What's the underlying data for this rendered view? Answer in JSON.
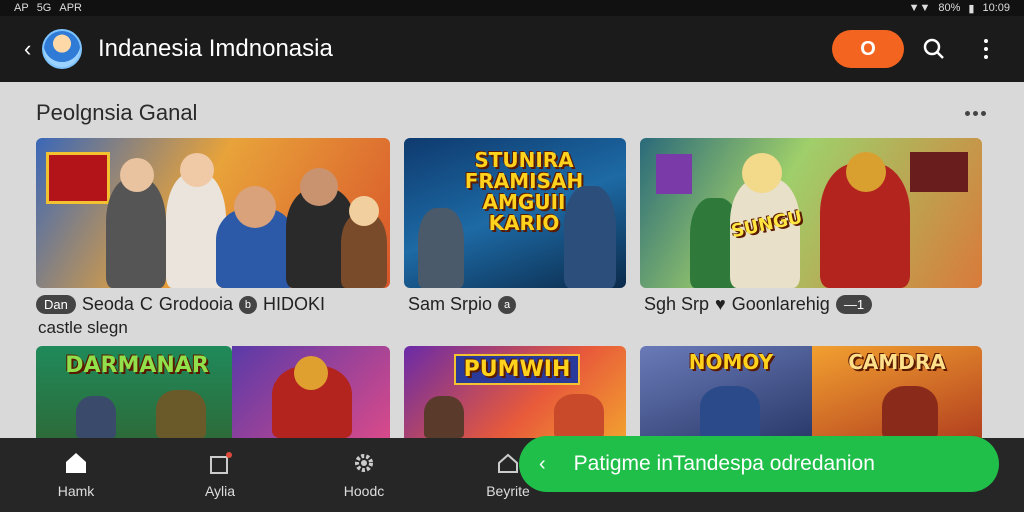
{
  "status_bar": {
    "left_text": "AP",
    "left_icon_text": "5G",
    "left_label": "APR",
    "battery": "80%",
    "time": "10:09"
  },
  "app_bar": {
    "back_icon": "arrow-left-icon",
    "title": "Indanesia Imdnonasia",
    "action_label": "O"
  },
  "section": {
    "title": "Peolgnsia Ganal"
  },
  "cards": [
    {
      "banner": "",
      "badge": "Dan",
      "title": "Seoda",
      "subtitle": "Grodooia",
      "circle_label": "b",
      "extra": "HIDOKI",
      "line2": "castle slegn"
    },
    {
      "banner": "STUNIRA FRAMISAH AMGUII KARIO",
      "title": "Sam Srpio",
      "circle_label": "a"
    },
    {
      "banner": "SUNGU",
      "title": "Sgh Srp",
      "subtitle": "Goonlarehig",
      "count_label": "—1"
    },
    {
      "banner": "DARMANAR"
    },
    {
      "banner": "PUMWIH"
    },
    {
      "banner": "NOMOY"
    },
    {
      "banner": "CAMDRA"
    }
  ],
  "bottom_nav": [
    {
      "label": "Hamk",
      "icon": "home-icon"
    },
    {
      "label": "Aylia",
      "icon": "edit-icon"
    },
    {
      "label": "Hoodc",
      "icon": "gear-icon"
    },
    {
      "label": "Beyrite",
      "icon": "badge-icon"
    }
  ],
  "toast": {
    "text": "Patigme inTandespa odredanion"
  },
  "colors": {
    "accent_orange": "#f2641f",
    "toast_green": "#1fbf4a",
    "appbar": "#1b1b1b"
  }
}
